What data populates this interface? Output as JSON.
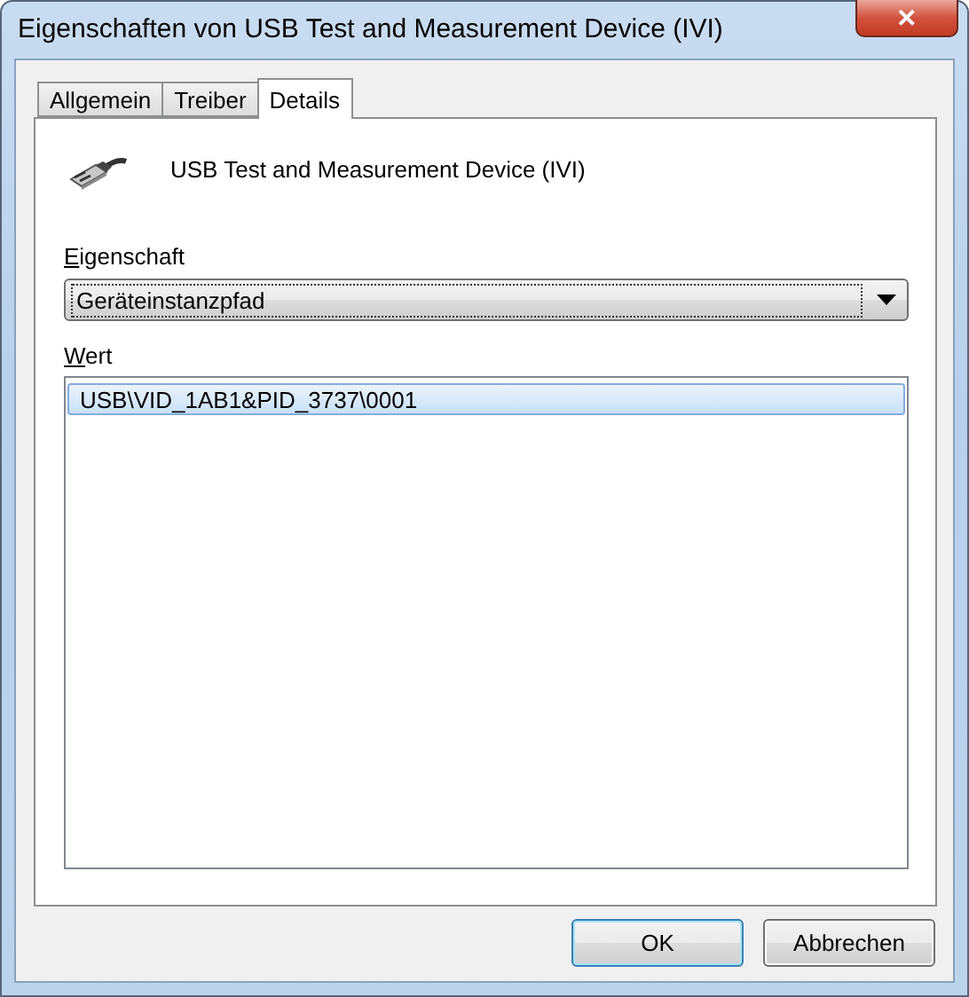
{
  "window": {
    "title": "Eigenschaften von USB Test and Measurement Device (IVI)",
    "close": "✕"
  },
  "tabs": [
    {
      "label": "Allgemein",
      "selected": false
    },
    {
      "label": "Treiber",
      "selected": false
    },
    {
      "label": "Details",
      "selected": true
    }
  ],
  "device": {
    "name": "USB Test and Measurement Device (IVI)"
  },
  "property": {
    "label": "Eigenschaft",
    "value": "Geräteinstanzpfad"
  },
  "value": {
    "label": "Wert",
    "rows": [
      {
        "text": "USB\\VID_1AB1&PID_3737\\0001",
        "selected": true
      }
    ]
  },
  "buttons": [
    {
      "label": "OK",
      "default": true
    },
    {
      "label": "Abbrechen",
      "default": false
    }
  ]
}
